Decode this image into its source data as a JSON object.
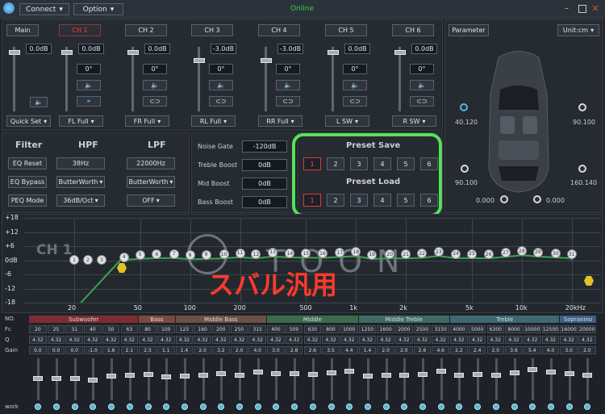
{
  "menu": {
    "connect": "Connect",
    "option": "Option",
    "status": "Online"
  },
  "channels": [
    {
      "name": "Main",
      "gain": "0.0dB",
      "bottom": "Quick Set"
    },
    {
      "name": "CH 1",
      "gain": "0.0dB",
      "phase": "0°",
      "bottom": "FL Full"
    },
    {
      "name": "CH 2",
      "gain": "0.0dB",
      "phase": "0°",
      "bottom": "FR Full"
    },
    {
      "name": "CH 3",
      "gain": "-3.0dB",
      "phase": "0°",
      "bottom": "RL Full"
    },
    {
      "name": "CH 4",
      "gain": "-3.0dB",
      "phase": "0°",
      "bottom": "RR Full"
    },
    {
      "name": "CH 5",
      "gain": "0.0dB",
      "phase": "0°",
      "bottom": "L SW"
    },
    {
      "name": "CH 6",
      "gain": "0.0dB",
      "phase": "0°",
      "bottom": "R SW"
    }
  ],
  "parameter": {
    "label": "Parameter",
    "unit": "Unit:cm",
    "fl": "40.120",
    "fr": "90.100",
    "rl": "90.100",
    "rr": "160.140",
    "sl": "0.000",
    "sr": "0.000"
  },
  "filter": {
    "title": "Filter",
    "hpf": "HPF",
    "lpf": "LPF",
    "rows": [
      {
        "label": "EQ Reset",
        "hpf": "38Hz",
        "lpf": "22000Hz"
      },
      {
        "label": "EQ Bypass",
        "hpf": "ButterWorth",
        "lpf": "ButterWorth"
      },
      {
        "label": "PEQ Mode",
        "hpf": "36dB/Oct",
        "lpf": "OFF"
      }
    ]
  },
  "gates": [
    {
      "label": "Noise Gate",
      "value": "-120dB"
    },
    {
      "label": "Treble Boost",
      "value": "0dB"
    },
    {
      "label": "Mid Boost",
      "value": "0dB"
    },
    {
      "label": "Bass Boost",
      "value": "0dB"
    }
  ],
  "preset": {
    "save_title": "Preset Save",
    "load_title": "Preset Load",
    "slots": [
      "1",
      "2",
      "3",
      "4",
      "5",
      "6"
    ]
  },
  "graph": {
    "ch_label": "CH 1",
    "watermark": "TOON",
    "jp_text": "スバル汎用",
    "y_ticks": [
      "+18",
      "+12",
      "+6",
      "0dB",
      "-6",
      "-12",
      "-18"
    ],
    "x_ticks": [
      "20",
      "50",
      "100",
      "200",
      "500",
      "1k",
      "2k",
      "5k",
      "10k",
      "20kHz"
    ]
  },
  "eq": {
    "no_label": "NO.",
    "fc_label": "Fc",
    "q_label": "Q",
    "gain_label": "Gain",
    "work_label": "work",
    "bands": [
      {
        "name": "Subwoofer",
        "color": "#7c2d31"
      },
      {
        "name": "Bass",
        "color": "#7c4a3c"
      },
      {
        "name": "Middle Bass",
        "color": "#6d5046"
      },
      {
        "name": "Middle",
        "color": "#3d6a4f"
      },
      {
        "name": "Middle Treble",
        "color": "#3f6a62"
      },
      {
        "name": "Treble",
        "color": "#3d6a72"
      },
      {
        "name": "Sopranino",
        "color": "#3d5f86"
      }
    ],
    "fc": [
      "20",
      "25",
      "31",
      "40",
      "50",
      "63",
      "80",
      "100",
      "125",
      "160",
      "200",
      "250",
      "315",
      "400",
      "500",
      "630",
      "800",
      "1000",
      "1250",
      "1600",
      "2000",
      "2500",
      "3150",
      "4000",
      "5000",
      "6300",
      "8000",
      "10000",
      "12500",
      "16000",
      "20000"
    ],
    "q": [
      "4.32",
      "4.32",
      "4.32",
      "4.32",
      "4.32",
      "4.32",
      "4.32",
      "4.32",
      "4.32",
      "4.32",
      "4.32",
      "4.32",
      "4.32",
      "4.32",
      "4.32",
      "4.32",
      "4.32",
      "4.32",
      "4.32",
      "4.32",
      "4.32",
      "4.32",
      "4.32",
      "4.32",
      "4.32",
      "4.32",
      "4.32",
      "4.32",
      "4.32",
      "4.32",
      "4.32"
    ],
    "gain": [
      "0.0",
      "0.0",
      "0.0",
      "-1.0",
      "1.6",
      "2.1",
      "2.5",
      "1.1",
      "1.4",
      "2.0",
      "3.2",
      "2.0",
      "4.0",
      "3.0",
      "2.8",
      "2.6",
      "3.5",
      "4.4",
      "1.4",
      "2.0",
      "2.0",
      "2.6",
      "4.6",
      "2.2",
      "2.4",
      "2.0",
      "3.6",
      "5.4",
      "4.0",
      "3.0",
      "2.0"
    ]
  }
}
